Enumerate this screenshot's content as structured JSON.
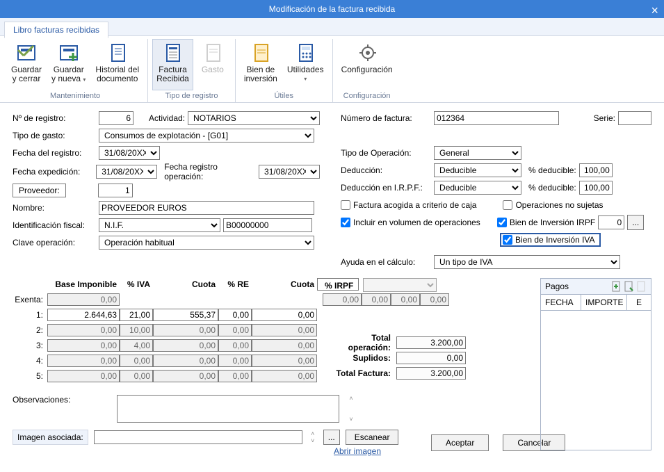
{
  "window": {
    "title": "Modificación de la factura recibida"
  },
  "tab": {
    "label": "Libro facturas recibidas"
  },
  "ribbon": {
    "groups": [
      {
        "label": "Mantenimiento",
        "buttons": [
          {
            "line1": "Guardar",
            "line2": "y cerrar"
          },
          {
            "line1": "Guardar",
            "line2": "y nueva",
            "dd": true
          },
          {
            "line1": "Historial del",
            "line2": "documento"
          }
        ]
      },
      {
        "label": "Tipo de registro",
        "buttons": [
          {
            "line1": "Factura",
            "line2": "Recibida",
            "selected": true
          },
          {
            "line1": "Gasto",
            "line2": "",
            "disabled": true
          }
        ]
      },
      {
        "label": "Útiles",
        "buttons": [
          {
            "line1": "Bien de",
            "line2": "inversión"
          },
          {
            "line1": "Utilidades",
            "line2": "",
            "dd": true
          }
        ]
      },
      {
        "label": "Configuración",
        "buttons": [
          {
            "line1": "Configuración",
            "line2": ""
          }
        ]
      }
    ]
  },
  "left": {
    "nregistro_lbl": "Nº de registro:",
    "nregistro_val": "6",
    "actividad_lbl": "Actividad:",
    "actividad_val": "NOTARIOS",
    "tipogasto_lbl": "Tipo de gasto:",
    "tipogasto_val": "Consumos de explotación - [G01]",
    "fecharegistro_lbl": "Fecha del registro:",
    "fecharegistro_val": "31/08/20XX",
    "fechaexp_lbl": "Fecha expedición:",
    "fechaexp_val": "31/08/20XX",
    "fechaop_lbl": "Fecha registro operación:",
    "fechaop_val": "31/08/20XX",
    "proveedor_btn": "Proveedor:",
    "proveedor_val": "1",
    "nombre_lbl": "Nombre:",
    "nombre_val": "PROVEEDOR EUROS",
    "idfiscal_lbl": "Identificación fiscal:",
    "idfiscal_tipo": "N.I.F.",
    "idfiscal_val": "B00000000",
    "claveop_lbl": "Clave operación:",
    "claveop_val": "Operación habitual"
  },
  "right": {
    "numfact_lbl": "Número de factura:",
    "numfact_val": "012364",
    "serie_lbl": "Serie:",
    "serie_val": "",
    "tipoop_lbl": "Tipo de Operación:",
    "tipoop_val": "General",
    "deduccion_lbl": "Deducción:",
    "deduccion_val": "Deducible",
    "pct1_lbl": "% deducible:",
    "pct1_val": "100,00",
    "dedirpf_lbl": "Deducción en I.R.P.F.:",
    "dedirpf_val": "Deducible",
    "pct2_lbl": "% deducible:",
    "pct2_val": "100,00",
    "chk_caja": "Factura acogida a criterio de caja",
    "chk_nosujetas": "Operaciones no sujetas",
    "chk_volumen": "Incluir en  volumen de operaciones",
    "chk_bienirpf": "Bien de Inversión IRPF",
    "bienirpf_val": "0",
    "chk_bieniva": "Bien de Inversión IVA",
    "ayuda_lbl": "Ayuda en el cálculo:",
    "ayuda_val": "Un tipo de IVA"
  },
  "grid": {
    "headers": {
      "base": "Base Imponible",
      "iva": "% IVA",
      "cuota": "Cuota",
      "re": "% RE",
      "cuotare": "Cuota",
      "irpf": "% IRPF"
    },
    "exenta_lbl": "Exenta:",
    "rowlabels": [
      "1:",
      "2:",
      "3:",
      "4:",
      "5:"
    ],
    "exenta": {
      "base": "0,00"
    },
    "rows": [
      {
        "base": "2.644,63",
        "iva": "21,00",
        "cuota": "555,37",
        "re": "0,00",
        "cuotare": "0,00"
      },
      {
        "base": "0,00",
        "iva": "10,00",
        "cuota": "0,00",
        "re": "0,00",
        "cuotare": "0,00"
      },
      {
        "base": "0,00",
        "iva": "4,00",
        "cuota": "0,00",
        "re": "0,00",
        "cuotare": "0,00"
      },
      {
        "base": "0,00",
        "iva": "0,00",
        "cuota": "0,00",
        "re": "0,00",
        "cuotare": "0,00"
      },
      {
        "base": "0,00",
        "iva": "0,00",
        "cuota": "0,00",
        "re": "0,00",
        "cuotare": "0,00"
      }
    ],
    "irpf_row": {
      "a": "0,00",
      "b": "0,00",
      "c": "0,00",
      "d": "0,00"
    },
    "totals": {
      "op_lbl": "Total operación:",
      "op_val": "3.200,00",
      "sup_lbl": "Suplidos:",
      "sup_val": "0,00",
      "fac_lbl": "Total Factura:",
      "fac_val": "3.200,00"
    }
  },
  "obs_lbl": "Observaciones:",
  "img_lbl": "Imagen asociada:",
  "dots": "...",
  "escanear": "Escanear",
  "abrir": "Abrir imagen",
  "aceptar": "Aceptar",
  "cancelar": "Cancelar",
  "pagos": {
    "title": "Pagos",
    "col1": "FECHA",
    "col2": "IMPORTE",
    "col3": "E"
  }
}
